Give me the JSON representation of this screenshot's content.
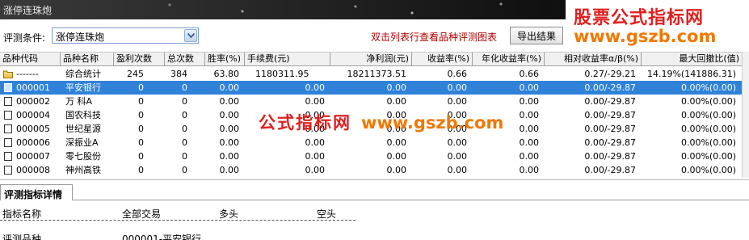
{
  "window": {
    "title": "涨停连珠炮"
  },
  "brand": {
    "line1": "股票公式指标网",
    "line2": "www.gszb.com"
  },
  "watermark": {
    "cn": "公式指标网",
    "url": "www.gszb.com"
  },
  "condition": {
    "label": "评测条件:",
    "value": "涨停连珠炮"
  },
  "hint": "双击列表行查看品种评测图表",
  "export_label": "导出结果",
  "columns": [
    "品种代码",
    "品种名称",
    "盈利次数",
    "总次数",
    "胜率(%)",
    "手续费(元)",
    "净利润(元)",
    "收益率(%)",
    "年化收益率(%)",
    "相对收益率α/β(%)",
    "最大回撤比(值)"
  ],
  "summary_row": {
    "code": "-------",
    "name": "综合统计",
    "wins": "245",
    "total": "384",
    "rate": "63.80",
    "fee": "1180311.95",
    "profit": "18211373.51",
    "ret": "0.66",
    "annual": "0.66",
    "relative": "0.27/-29.21",
    "drawdown": "14.19%(141886.31)"
  },
  "rows": [
    {
      "code": "000001",
      "name": "平安银行",
      "wins": "0",
      "total": "0",
      "rate": "0.00",
      "fee": "0.00",
      "profit": "0.00",
      "ret": "0.00",
      "annual": "0.00",
      "relative": "0.00/-29.87",
      "drawdown": "0.00%(0.00)"
    },
    {
      "code": "000002",
      "name": "万 科A",
      "wins": "0",
      "total": "0",
      "rate": "0.00",
      "fee": "0.00",
      "profit": "0.00",
      "ret": "0.00",
      "annual": "0.00",
      "relative": "0.00/-29.87",
      "drawdown": "0.00%(0.00)"
    },
    {
      "code": "000004",
      "name": "国农科技",
      "wins": "0",
      "total": "0",
      "rate": "0.00",
      "fee": "0.00",
      "profit": "0.00",
      "ret": "0.00",
      "annual": "0.00",
      "relative": "0.00/-29.87",
      "drawdown": "0.00%(0.00)"
    },
    {
      "code": "000005",
      "name": "世纪星源",
      "wins": "0",
      "total": "0",
      "rate": "0.00",
      "fee": "0.00",
      "profit": "0.00",
      "ret": "0.00",
      "annual": "0.00",
      "relative": "0.00/-29.87",
      "drawdown": "0.00%(0.00)"
    },
    {
      "code": "000006",
      "name": "深振业A",
      "wins": "0",
      "total": "0",
      "rate": "0.00",
      "fee": "0.00",
      "profit": "0.00",
      "ret": "0.00",
      "annual": "0.00",
      "relative": "0.00/-29.87",
      "drawdown": "0.00%(0.00)"
    },
    {
      "code": "000007",
      "name": "零七股份",
      "wins": "0",
      "total": "0",
      "rate": "0.00",
      "fee": "0.00",
      "profit": "0.00",
      "ret": "0.00",
      "annual": "0.00",
      "relative": "0.00/-29.87",
      "drawdown": "0.00%(0.00)"
    },
    {
      "code": "000008",
      "name": "神州高铁",
      "wins": "0",
      "total": "0",
      "rate": "0.00",
      "fee": "0.00",
      "profit": "0.00",
      "ret": "0.00",
      "annual": "0.00",
      "relative": "0.00/-29.87",
      "drawdown": "0.00%(0.00)"
    }
  ],
  "selected_row_index": 0,
  "detail": {
    "tab_label": "评测指标详情",
    "headers": [
      "指标名称",
      "全部交易",
      "多头",
      "空头"
    ],
    "first_row": {
      "name": "评测品种",
      "all": "000001-平安银行"
    }
  },
  "colors": {
    "selected_row": "#2f82d8",
    "brand_red": "#e02020",
    "brand_orange": "#f07800",
    "hint_red": "#b00000"
  }
}
